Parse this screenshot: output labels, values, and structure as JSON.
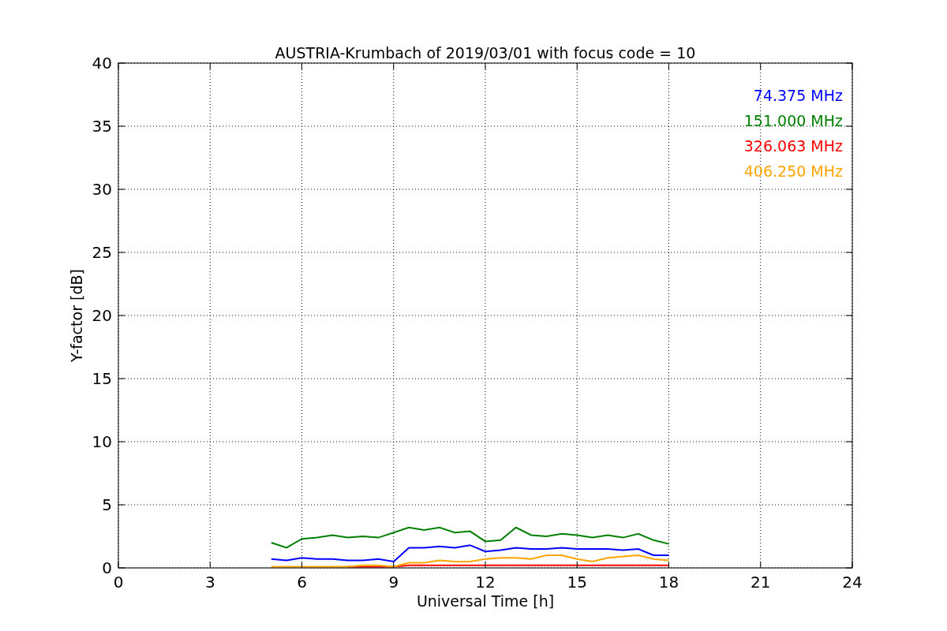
{
  "chart_data": {
    "type": "line",
    "title": "AUSTRIA-Krumbach of 2019/03/01 with focus code = 10",
    "xlabel": "Universal Time [h]",
    "ylabel": "Y-factor [dB]",
    "x": [
      5,
      5.5,
      6,
      6.5,
      7,
      7.5,
      8,
      8.5,
      9,
      9.5,
      10,
      10.5,
      11,
      11.5,
      12,
      12.5,
      13,
      13.5,
      14,
      14.5,
      15,
      15.5,
      16,
      16.5,
      17,
      17.5,
      18
    ],
    "series": [
      {
        "name": "74.375 MHz",
        "color": "#0000ff",
        "values": [
          0.7,
          0.6,
          0.8,
          0.7,
          0.7,
          0.6,
          0.6,
          0.7,
          0.5,
          1.6,
          1.6,
          1.7,
          1.6,
          1.8,
          1.3,
          1.4,
          1.6,
          1.5,
          1.5,
          1.6,
          1.5,
          1.5,
          1.5,
          1.4,
          1.5,
          1.0,
          1.0
        ]
      },
      {
        "name": "151.000 MHz",
        "color": "#008000",
        "values": [
          2.0,
          1.6,
          2.3,
          2.4,
          2.6,
          2.4,
          2.5,
          2.4,
          2.8,
          3.2,
          3.0,
          3.2,
          2.8,
          2.9,
          2.1,
          2.2,
          3.2,
          2.6,
          2.5,
          2.7,
          2.6,
          2.4,
          2.6,
          2.4,
          2.7,
          2.2,
          1.9
        ]
      },
      {
        "name": "326.063 MHz",
        "color": "#ff0000",
        "values": [
          null,
          null,
          null,
          null,
          null,
          0.1,
          0.1,
          0.1,
          0.1,
          0.2,
          0.2,
          0.2,
          0.2,
          0.2,
          0.2,
          0.2,
          0.2,
          0.2,
          0.2,
          0.2,
          0.2,
          0.2,
          0.2,
          0.2,
          0.2,
          0.2,
          0.2
        ]
      },
      {
        "name": "406.250 MHz",
        "color": "#ffa500",
        "values": [
          0.1,
          0.1,
          0.1,
          0.1,
          0.1,
          0.1,
          0.2,
          0.2,
          0.1,
          0.4,
          0.4,
          0.6,
          0.5,
          0.5,
          0.7,
          0.8,
          0.8,
          0.7,
          1.0,
          1.0,
          0.7,
          0.5,
          0.8,
          0.9,
          1.0,
          0.7,
          0.6
        ]
      }
    ],
    "grid": true,
    "xlim": [
      0,
      24
    ],
    "ylim": [
      0,
      40
    ],
    "xticks": [
      0,
      3,
      6,
      9,
      12,
      15,
      18,
      21,
      24
    ],
    "yticks": [
      0,
      5,
      10,
      15,
      20,
      25,
      30,
      35,
      40
    ]
  }
}
